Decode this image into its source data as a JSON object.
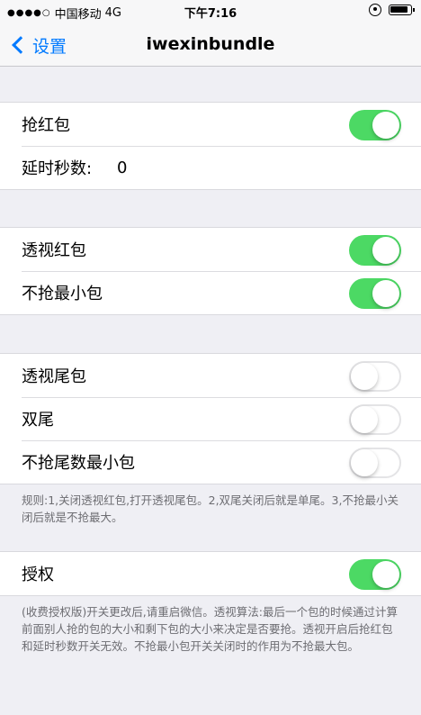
{
  "status_bar": {
    "signal": "●●●●○",
    "carrier": "中国移动",
    "network": "4G",
    "time": "下午7:16"
  },
  "nav": {
    "back_label": "设置",
    "title": "iwexinbundle"
  },
  "group1": {
    "grab_label": "抢红包",
    "grab_on": true,
    "delay_label": "延时秒数:",
    "delay_value": "0"
  },
  "group2": {
    "peek_label": "透视红包",
    "peek_on": true,
    "no_min_label": "不抢最小包",
    "no_min_on": true
  },
  "group3": {
    "peek_tail_label": "透视尾包",
    "peek_tail_on": false,
    "double_tail_label": "双尾",
    "double_tail_on": false,
    "no_tail_min_label": "不抢尾数最小包",
    "no_tail_min_on": false
  },
  "rules_note": "规则:1,关闭透视红包,打开透视尾包。2,双尾关闭后就是单尾。3,不抢最小关闭后就是不抢最大。",
  "group4": {
    "auth_label": "授权",
    "auth_on": true
  },
  "auth_note": "(收费授权版)开关更改后,请重启微信。透视算法:最后一个包的时候通过计算前面别人抢的包的大小和剩下包的大小来决定是否要抢。透视开启后抢红包和延时秒数开关无效。不抢最小包开关关闭时的作用为不抢最大包。",
  "colors": {
    "accent": "#007aff",
    "toggle_on": "#4cd964",
    "background": "#efeff4"
  }
}
